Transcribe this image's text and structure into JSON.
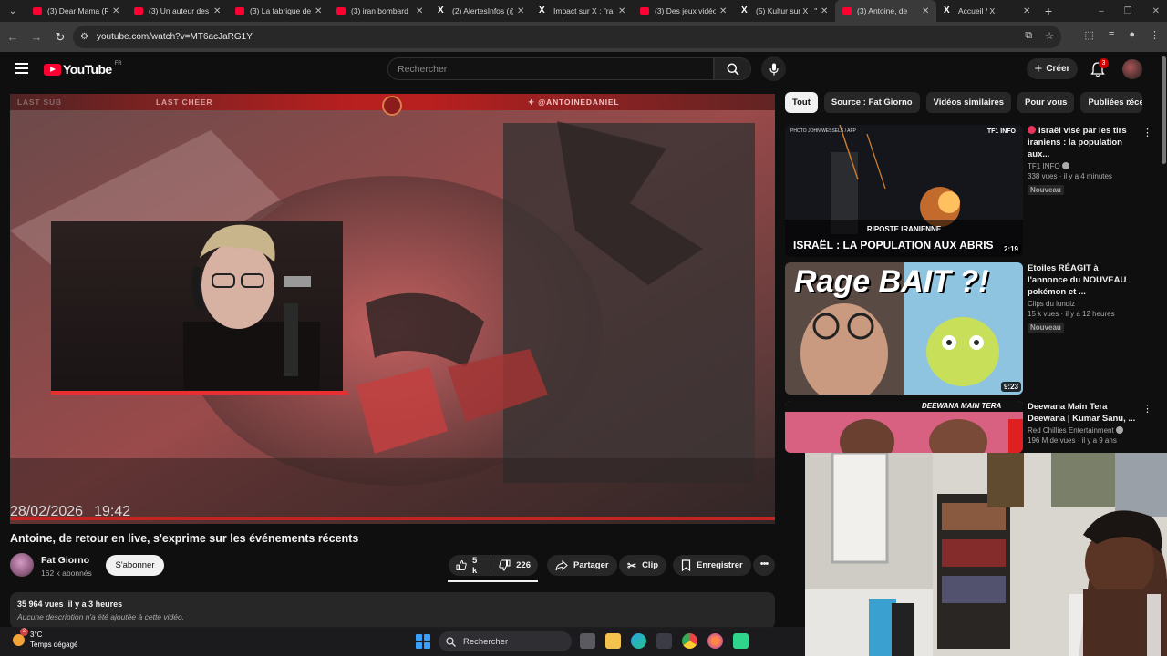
{
  "browser": {
    "tabs": [
      {
        "title": "(3) Dear Mama (F",
        "icon": "youtube-icon"
      },
      {
        "title": "(3) Un auteur des",
        "icon": "youtube-icon"
      },
      {
        "title": "(3) La fabrique de",
        "icon": "youtube-icon"
      },
      {
        "title": "(3) iran bombard",
        "icon": "youtube-icon"
      },
      {
        "title": "(2) AlertesInfos (@",
        "icon": "x-icon"
      },
      {
        "title": "Impact sur X : \"ra",
        "icon": "x-icon"
      },
      {
        "title": "(3) Des jeux vidéo",
        "icon": "youtube-icon"
      },
      {
        "title": "(5) Kultur sur X : \"",
        "icon": "x-icon"
      },
      {
        "title": "(3) Antoine, de",
        "icon": "youtube-icon"
      },
      {
        "title": "Accueil / X",
        "icon": "x-icon"
      }
    ],
    "url": "youtube.com/watch?v=MT6acJaRG1Y"
  },
  "youtube": {
    "logo_text": "YouTube",
    "country": "FR",
    "search_placeholder": "Rechercher",
    "create_label": "Créer",
    "notif_count": "3"
  },
  "video": {
    "overlay": {
      "last_sub": "LAST SUB",
      "last_cheer": "LAST CHEER",
      "handle": "@ANTOINEDANIEL"
    },
    "date": "28/02/2026",
    "time": "19:42",
    "title": "Antoine, de retour en live, s'exprime sur les événements récents",
    "channel": "Fat Giorno",
    "subscribers": "162 k abonnés",
    "subscribe_label": "S'abonner",
    "likes": "5 k",
    "dislikes": "226",
    "share_label": "Partager",
    "clip_label": "Clip",
    "save_label": "Enregistrer",
    "views": "35 964 vues",
    "age": "il y a 3 heures",
    "description": "Aucune description n'a été ajoutée à cette vidéo."
  },
  "chips": [
    "Tout",
    "Source : Fat Giorno",
    "Vidéos similaires",
    "Pour vous",
    "Publiées réce"
  ],
  "recommendations": [
    {
      "title": "Israël visé par les tirs iraniens : la population aux...",
      "channel": "TF1 INFO",
      "meta": "338 vues · il y a 4 minutes",
      "badge": "Nouveau",
      "duration": "2:19",
      "thumb_caption_top": "RIPOSTE IRANIENNE",
      "thumb_caption": "ISRAËL : LA POPULATION AUX ABRIS",
      "thumb_brand": "TF1 INFO",
      "thumb_credit": "PHOTO JOHN WESSELS / AFP"
    },
    {
      "title": "Etoiles RÉAGIT à l'annonce du NOUVEAU pokémon et ...",
      "channel": "Clips du lundiz",
      "meta": "15 k vues · il y a 12 heures",
      "badge": "Nouveau",
      "duration": "9:23",
      "thumb_caption": "Rage BAIT ?!"
    },
    {
      "title": "Deewana Main Tera Deewana | Kumar Sanu, ...",
      "channel": "Red Chillies Entertainment",
      "meta": "196 M de vues · il y a 9 ans",
      "thumb_caption": "DEEWANA MAIN TERA"
    }
  ],
  "taskbar": {
    "temperature": "3°C",
    "weather": "Temps dégagé",
    "weather_badge": "2",
    "search_label": "Rechercher"
  },
  "colors": {
    "youtube_red": "#ff0033",
    "overlay_red": "#b81f1f",
    "background": "#0f0f0f"
  }
}
